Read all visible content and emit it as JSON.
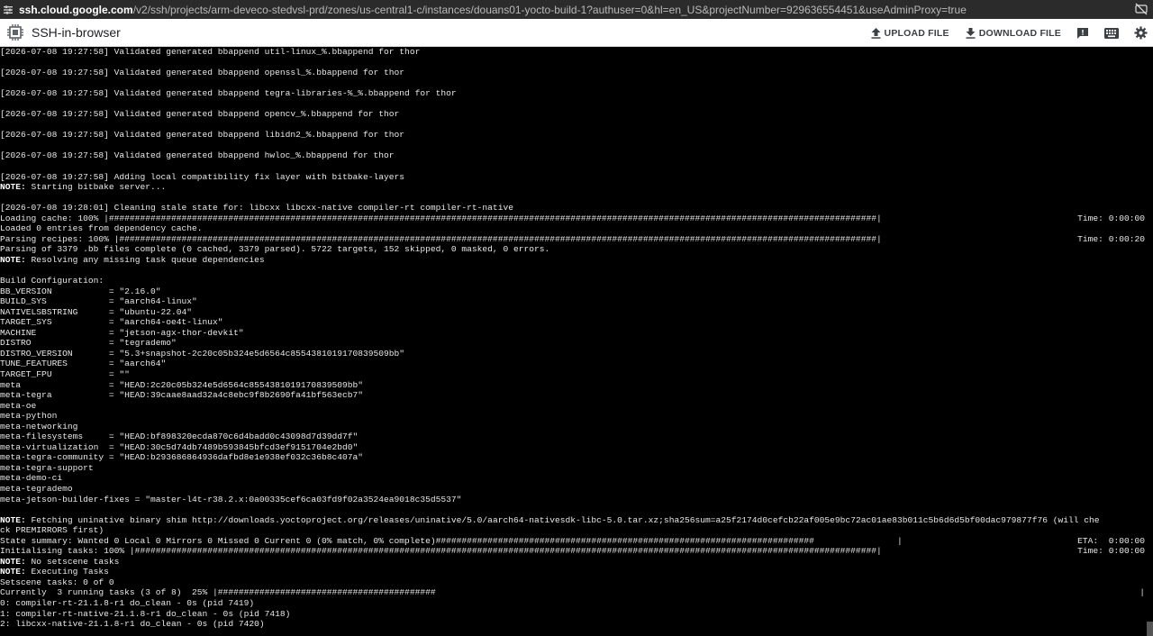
{
  "browser": {
    "url_host": "ssh.cloud.google.com",
    "url_path": "/v2/ssh/projects/arm-deveco-stedvsl-prd/zones/us-central1-c/instances/douans01-yocto-build-1?authuser=0&hl=en_US&projectNumber=929636554451&useAdminProxy=true",
    "site_icon": "tune-icon",
    "visibility_icon": "eye-off-icon"
  },
  "toolbar": {
    "title": "SSH-in-browser",
    "upload_label": "UPLOAD FILE",
    "download_label": "DOWNLOAD FILE",
    "icons": [
      "feedback-icon",
      "keyboard-icon",
      "settings-icon"
    ]
  },
  "colors": {
    "terminal_bg": "#000000",
    "terminal_fg": "#e8e8e8",
    "urlbar_bg": "#2b2b2b",
    "toolbar_bg": "#ffffff"
  },
  "terminal": {
    "lines": [
      {
        "text": "[2026-07-08 19:27:58] Validated generated bbappend util-linux_%.bbappend for thor"
      },
      {
        "text": ""
      },
      {
        "text": "[2026-07-08 19:27:58] Validated generated bbappend openssl_%.bbappend for thor"
      },
      {
        "text": ""
      },
      {
        "text": "[2026-07-08 19:27:58] Validated generated bbappend tegra-libraries-%_%.bbappend for thor"
      },
      {
        "text": ""
      },
      {
        "text": "[2026-07-08 19:27:58] Validated generated bbappend opencv_%.bbappend for thor"
      },
      {
        "text": ""
      },
      {
        "text": "[2026-07-08 19:27:58] Validated generated bbappend libidn2_%.bbappend for thor"
      },
      {
        "text": ""
      },
      {
        "text": "[2026-07-08 19:27:58] Validated generated bbappend hwloc_%.bbappend for thor"
      },
      {
        "text": ""
      },
      {
        "text": "[2026-07-08 19:27:58] Adding local compatibility fix layer with bitbake-layers"
      },
      {
        "note": "NOTE:",
        "text": " Starting bitbake server..."
      },
      {
        "text": ""
      },
      {
        "text": "[2026-07-08 19:28:01] Cleaning stale state for: libcxx libcxx-native compiler-rt compiler-rt-native"
      },
      {
        "text": "Loading cache: 100% |####################################################################################################################################################| ",
        "right": "Time: 0:00:00"
      },
      {
        "text": "Loaded 0 entries from dependency cache."
      },
      {
        "text": "Parsing recipes: 100% |##################################################################################################################################################| ",
        "right": "Time: 0:00:20"
      },
      {
        "text": "Parsing of 3379 .bb files complete (0 cached, 3379 parsed). 5722 targets, 152 skipped, 0 masked, 0 errors."
      },
      {
        "note": "NOTE:",
        "text": " Resolving any missing task queue dependencies"
      },
      {
        "text": ""
      },
      {
        "text": "Build Configuration:"
      },
      {
        "text": "BB_VERSION           = \"2.16.0\""
      },
      {
        "text": "BUILD_SYS            = \"aarch64-linux\""
      },
      {
        "text": "NATIVELSBSTRING      = \"ubuntu-22.04\""
      },
      {
        "text": "TARGET_SYS           = \"aarch64-oe4t-linux\""
      },
      {
        "text": "MACHINE              = \"jetson-agx-thor-devkit\""
      },
      {
        "text": "DISTRO               = \"tegrademo\""
      },
      {
        "text": "DISTRO_VERSION       = \"5.3+snapshot-2c20c05b324e5d6564c8554381019170839509bb\""
      },
      {
        "text": "TUNE_FEATURES        = \"aarch64\""
      },
      {
        "text": "TARGET_FPU           = \"\""
      },
      {
        "text": "meta                 = \"HEAD:2c20c05b324e5d6564c8554381019170839509bb\""
      },
      {
        "text": "meta-tegra           = \"HEAD:39caae8aad32a4c8ebc9f8b2690fa41bf563ecb7\""
      },
      {
        "text": "meta-oe"
      },
      {
        "text": "meta-python"
      },
      {
        "text": "meta-networking"
      },
      {
        "text": "meta-filesystems     = \"HEAD:bf898320ecda870c6d4badd0c43098d7d39dd7f\""
      },
      {
        "text": "meta-virtualization  = \"HEAD:30c5d74db7489b593845bfcd3ef9151704e2bd0\""
      },
      {
        "text": "meta-tegra-community = \"HEAD:b293686864936dafbd8e1e938ef032c36b8c407a\""
      },
      {
        "text": "meta-tegra-support"
      },
      {
        "text": "meta-demo-ci"
      },
      {
        "text": "meta-tegrademo"
      },
      {
        "text": "meta-jetson-builder-fixes = \"master-l4t-r38.2.x:0a00335cef6ca03fd9f02a3524ea9018c35d5537\""
      },
      {
        "text": ""
      },
      {
        "note": "NOTE:",
        "text": " Fetching uninative binary shim http://downloads.yoctoproject.org/releases/uninative/5.0/aarch64-nativesdk-libc-5.0.tar.xz;sha256sum=a25f2174d0cefcb22af005e9bc72ac01ae83b011c5b6d6d5bf00dac979877f76 (will che"
      },
      {
        "text": "ck PREMIRRORS first)"
      },
      {
        "text": "State summary: Wanted 0 Local 0 Mirrors 0 Missed 0 Current 0 (0% match, 0% complete)#########################################################################                | ",
        "right": "ETA:  0:00:00"
      },
      {
        "text": "Initialising tasks: 100% |###############################################################################################################################################| ",
        "right": "Time: 0:00:00"
      },
      {
        "note": "NOTE:",
        "text": " No setscene tasks"
      },
      {
        "note": "NOTE:",
        "text": " Executing Tasks"
      },
      {
        "text": "Setscene tasks: 0 of 0"
      },
      {
        "text": "Currently  3 running tasks (3 of 8)  25% |##########################################",
        "right": "|"
      },
      {
        "text": "0: compiler-rt-21.1.8-r1 do_clean - 0s (pid 7419)"
      },
      {
        "text": "1: compiler-rt-native-21.1.8-r1 do_clean - 0s (pid 7418)"
      },
      {
        "text": "2: libcxx-native-21.1.8-r1 do_clean - 0s (pid 7420)"
      }
    ]
  }
}
